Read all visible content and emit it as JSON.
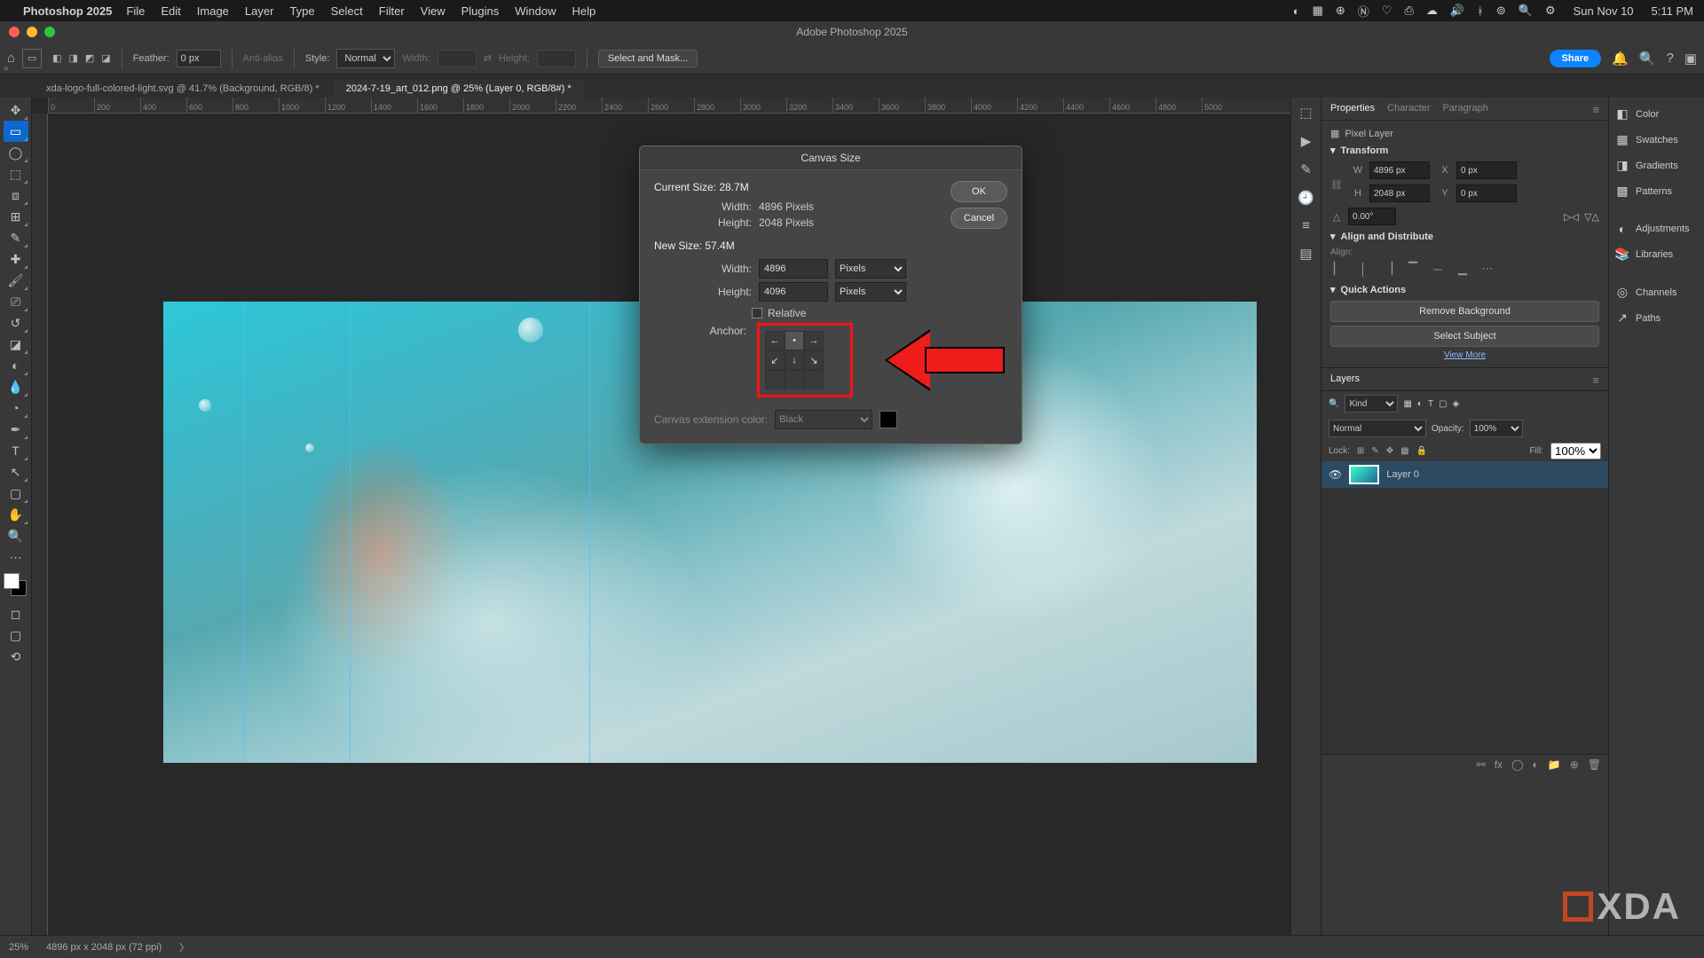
{
  "mac_menu": {
    "app": "Photoshop 2025",
    "items": [
      "File",
      "Edit",
      "Image",
      "Layer",
      "Type",
      "Select",
      "Filter",
      "View",
      "Plugins",
      "Window",
      "Help"
    ],
    "date": "Sun Nov 10",
    "time": "5:11 PM"
  },
  "window_title": "Adobe Photoshop 2025",
  "option_bar": {
    "feather_label": "Feather:",
    "feather_value": "0 px",
    "antialias": "Anti-alias",
    "style_label": "Style:",
    "style_value": "Normal",
    "width_label": "Width:",
    "height_label": "Height:",
    "select_mask": "Select and Mask...",
    "share": "Share"
  },
  "tabs": [
    "xda-logo-full-colored-light.svg @ 41.7% (Background, RGB/8) *",
    "2024-7-19_art_012.png @ 25% (Layer 0, RGB/8#) *"
  ],
  "ruler_marks": [
    "0",
    "200",
    "400",
    "600",
    "800",
    "1000",
    "1200",
    "1400",
    "1600",
    "1800",
    "2000",
    "2200",
    "2400",
    "2600",
    "2800",
    "3000",
    "3200",
    "3400",
    "3600",
    "3800",
    "4000",
    "4200",
    "4400",
    "4600",
    "4800",
    "5000"
  ],
  "dialog": {
    "title": "Canvas Size",
    "current_label": "Current Size: 28.7M",
    "cur_w_label": "Width:",
    "cur_w": "4896 Pixels",
    "cur_h_label": "Height:",
    "cur_h": "2048 Pixels",
    "new_label": "New Size: 57.4M",
    "new_w_label": "Width:",
    "new_w": "4896",
    "new_h_label": "Height:",
    "new_h": "4096",
    "unit": "Pixels",
    "relative": "Relative",
    "anchor_label": "Anchor:",
    "ext_label": "Canvas extension color:",
    "ext_value": "Black",
    "ok": "OK",
    "cancel": "Cancel"
  },
  "properties": {
    "tabs": [
      "Properties",
      "Character",
      "Paragraph"
    ],
    "layer_type": "Pixel Layer",
    "transform": "Transform",
    "w": "4896 px",
    "h": "2048 px",
    "x": "0 px",
    "y": "0 px",
    "angle": "0.00°",
    "align_head": "Align and Distribute",
    "align_label": "Align:",
    "qa_head": "Quick Actions",
    "qa_remove": "Remove Background",
    "qa_select": "Select Subject",
    "qa_more": "View More"
  },
  "layers": {
    "tab": "Layers",
    "kind": "Kind",
    "blend": "Normal",
    "opacity_label": "Opacity:",
    "opacity": "100%",
    "lock_label": "Lock:",
    "fill_label": "Fill:",
    "fill": "100%",
    "layer0": "Layer 0"
  },
  "far_panels": [
    "Color",
    "Swatches",
    "Gradients",
    "Patterns",
    "Adjustments",
    "Libraries",
    "Channels",
    "Paths"
  ],
  "status": {
    "zoom": "25%",
    "dims": "4896 px x 2048 px (72 ppi)"
  }
}
